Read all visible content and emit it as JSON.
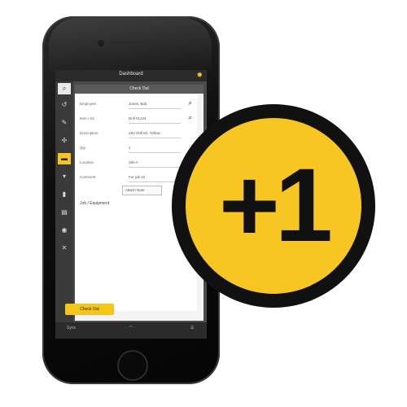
{
  "app": {
    "title": "Dashboard",
    "panel_title": "Check Out"
  },
  "sidebar": {
    "items": [
      {
        "icon": "search-icon",
        "glyph": "🔍"
      },
      {
        "icon": "arrow-icon",
        "glyph": "↺"
      },
      {
        "icon": "wrench-icon",
        "glyph": "✎"
      },
      {
        "icon": "gear-icon",
        "glyph": "✣"
      },
      {
        "icon": "box-icon",
        "glyph": "▬"
      },
      {
        "icon": "tag-icon",
        "glyph": "▾"
      },
      {
        "icon": "doc-icon",
        "glyph": "▮"
      },
      {
        "icon": "list-icon",
        "glyph": "▤"
      },
      {
        "icon": "person-icon",
        "glyph": "👤"
      },
      {
        "icon": "tools-icon",
        "glyph": "✕"
      }
    ]
  },
  "form": {
    "rows": [
      {
        "label": "Employee",
        "value": "Jones, Bob",
        "search": true
      },
      {
        "label": "Item / Kit",
        "value": "Drill #1234",
        "search": true
      },
      {
        "label": "Description",
        "value": "18V Drill Kit, Yellow",
        "search": false
      },
      {
        "label": "Qty",
        "value": "1",
        "search": false
      },
      {
        "label": "Location",
        "value": "Site A",
        "search": false
      },
      {
        "label": "Comment",
        "value": "For job 42",
        "search": false
      }
    ],
    "button_box": "Attach Note",
    "section": "Job / Equipment",
    "save_label": "Check Out"
  },
  "bottombar": {
    "left": "Sync",
    "right": "☰"
  },
  "badge": {
    "text": "+1"
  },
  "colors": {
    "accent": "#f7c623",
    "dark": "#111111"
  }
}
